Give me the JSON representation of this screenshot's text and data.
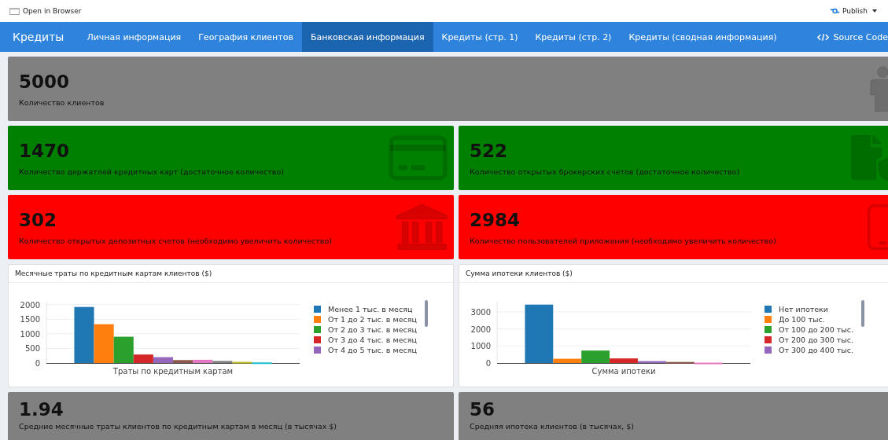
{
  "top_bar": {
    "open_in_browser": "Open in Browser",
    "publish": "Publish"
  },
  "navbar": {
    "title": "Кредиты",
    "tabs": [
      {
        "label": "Личная информация",
        "selected": false
      },
      {
        "label": "География клиентов",
        "selected": false
      },
      {
        "label": "Банковская информация",
        "selected": true
      },
      {
        "label": "Кредиты (стр. 1)",
        "selected": false
      },
      {
        "label": "Кредиты (стр. 2)",
        "selected": false
      },
      {
        "label": "Кредиты (сводная информация)",
        "selected": false
      }
    ],
    "source_code": "Source Code"
  },
  "value_box_rows": [
    [
      {
        "value": "5000",
        "label": "Количество клиентов",
        "color": "#808080",
        "kind": "person"
      }
    ],
    [
      {
        "value": "1470",
        "label": "Количество держатлей кредитных карт (достаточное количество)",
        "color": "#008000",
        "kind": "card"
      },
      {
        "value": "522",
        "label": "Количество открытых брокерских счетов (достаточное количество)",
        "color": "#008000",
        "kind": "document"
      }
    ],
    [
      {
        "value": "302",
        "label": "Количество открытых депозитных счетов (необходимо увеличить количество)",
        "color": "#ff0000",
        "kind": "bank"
      },
      {
        "value": "2984",
        "label": "Количество пользователей приложения (необходимо увеличить количество)",
        "color": "#ff0000",
        "kind": "phone"
      }
    ]
  ],
  "chart_boxes": [
    {
      "title": "Месячные траты по кредитным картам клиентов ($)",
      "chart_data": {
        "type": "bar",
        "grid": true,
        "categories": [
          "Траты по кредитным картам"
        ],
        "ylim": [
          0,
          2100
        ],
        "yticks": [
          0,
          500,
          1000,
          1500,
          2000
        ],
        "series": [
          {
            "name": "Менее 1 тыс. в месяц",
            "color": "#1f77b4",
            "values": [
              1920
            ]
          },
          {
            "name": "От 1 до 2 тыс. в месяц",
            "color": "#ff7f0e",
            "values": [
              1330
            ]
          },
          {
            "name": "От 2 до 3 тыс. в месяц",
            "color": "#2ca02c",
            "values": [
              900
            ]
          },
          {
            "name": "От 3 до 4 тыс. в месяц",
            "color": "#d62728",
            "values": [
              290
            ]
          },
          {
            "name": "От 4 до 5 тыс. в месяц",
            "color": "#9467bd",
            "values": [
              200
            ]
          },
          {
            "color": "#8c564b",
            "values": [
              100
            ]
          },
          {
            "color": "#e377c2",
            "values": [
              110
            ]
          },
          {
            "color": "#7f7f7f",
            "values": [
              70
            ]
          },
          {
            "color": "#bcbd22",
            "values": [
              40
            ]
          },
          {
            "color": "#17becf",
            "values": [
              20
            ]
          }
        ]
      }
    },
    {
      "title": "Сумма ипотеки клиентов ($)",
      "chart_data": {
        "type": "bar",
        "grid": true,
        "categories": [
          "Сумма ипотеки"
        ],
        "ylim": [
          0,
          3600
        ],
        "yticks": [
          0,
          1000,
          2000,
          3000
        ],
        "series": [
          {
            "name": "Нет ипотеки",
            "color": "#1f77b4",
            "values": [
              3430
            ]
          },
          {
            "name": "До 100 тыс.",
            "color": "#ff7f0e",
            "values": [
              250
            ]
          },
          {
            "name": "От 100 до 200 тыс.",
            "color": "#2ca02c",
            "values": [
              730
            ]
          },
          {
            "name": "От 200 до 300 тыс.",
            "color": "#d62728",
            "values": [
              270
            ]
          },
          {
            "name": "От 300 до 400 тыс.",
            "color": "#9467bd",
            "values": [
              110
            ]
          },
          {
            "color": "#8c564b",
            "values": [
              60
            ]
          },
          {
            "color": "#e377c2",
            "values": [
              20
            ]
          }
        ]
      }
    }
  ],
  "bottom_boxes": [
    {
      "value": "1.94",
      "label": "Средние месячные траты клиентов по кредитным картам в месяц (в тысячах $)",
      "color": "#808080"
    },
    {
      "value": "56",
      "label": "Средняя ипотека клиентов (в тысячах, $)",
      "color": "#808080"
    }
  ]
}
